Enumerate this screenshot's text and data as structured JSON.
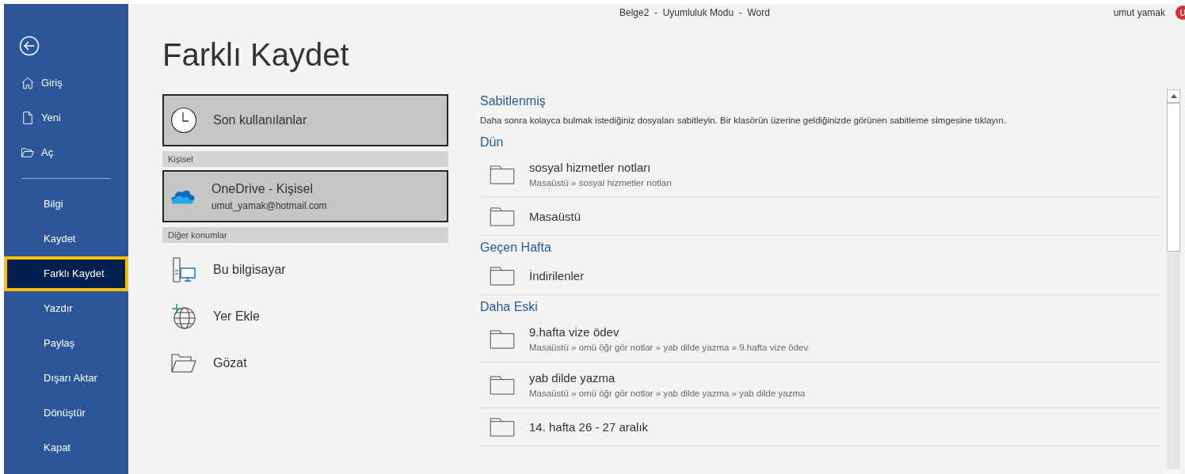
{
  "window": {
    "title": "Belge2  -  Uyumluluk Modu  -  Word",
    "user": "umut yamak",
    "avatar_initial": "U"
  },
  "sidebar": {
    "items": [
      {
        "kind": "home",
        "label": "Giriş",
        "selected": false
      },
      {
        "kind": "new",
        "label": "Yeni",
        "selected": false
      },
      {
        "kind": "open",
        "label": "Aç",
        "selected": false
      },
      {
        "kind": "text",
        "label": "Bilgi",
        "selected": false
      },
      {
        "kind": "text",
        "label": "Kaydet",
        "selected": false
      },
      {
        "kind": "text",
        "label": "Farklı Kaydet",
        "selected": true
      },
      {
        "kind": "text",
        "label": "Yazdır",
        "selected": false
      },
      {
        "kind": "text",
        "label": "Paylaş",
        "selected": false
      },
      {
        "kind": "text",
        "label": "Dışarı Aktar",
        "selected": false
      },
      {
        "kind": "text",
        "label": "Dönüştür",
        "selected": false
      },
      {
        "kind": "text",
        "label": "Kapat",
        "selected": false
      }
    ]
  },
  "page_title": "Farklı Kaydet",
  "locations": [
    {
      "kind": "recent",
      "label": "Son kullanılanlar",
      "selected": true
    },
    {
      "kind": "section",
      "label": "Kişisel"
    },
    {
      "kind": "onedrive",
      "label": "OneDrive - Kişisel",
      "sublabel": "umut_yamak@hotmail.com",
      "selected": true
    },
    {
      "kind": "section",
      "label": "Diğer konumlar"
    },
    {
      "kind": "computer",
      "label": "Bu bilgisayar",
      "selected": false
    },
    {
      "kind": "addplace",
      "label": "Yer Ekle",
      "selected": false
    },
    {
      "kind": "browse",
      "label": "Gözat",
      "selected": false
    }
  ],
  "folders": [
    {
      "kind": "heading",
      "label": "Sabitlenmiş"
    },
    {
      "kind": "note",
      "label": "Daha sonra kolayca bulmak istediğiniz dosyaları sabitleyin. Bir klasörün üzerine geldiğinizde görünen sabitleme simgesine tıklayın."
    },
    {
      "kind": "heading",
      "label": "Dün"
    },
    {
      "kind": "folder",
      "label": "sosyal hizmetler notları",
      "path": "Masaüstü » sosyal hizmetler notları"
    },
    {
      "kind": "folder",
      "label": "Masaüstü"
    },
    {
      "kind": "heading",
      "label": "Geçen Hafta"
    },
    {
      "kind": "folder",
      "label": "İndirilenler"
    },
    {
      "kind": "heading",
      "label": "Daha Eski"
    },
    {
      "kind": "folder",
      "label": "9.hafta vize ödev",
      "path": "Masaüstü » omü öğr gör notlar » yab dilde yazma » 9.hafta vize ödev"
    },
    {
      "kind": "folder",
      "label": "yab dilde yazma",
      "path": "Masaüstü » omü öğr gör notlar » yab dilde yazma » yab dilde yazma"
    },
    {
      "kind": "folder",
      "label": "14. hafta 26 - 27 aralık"
    }
  ]
}
